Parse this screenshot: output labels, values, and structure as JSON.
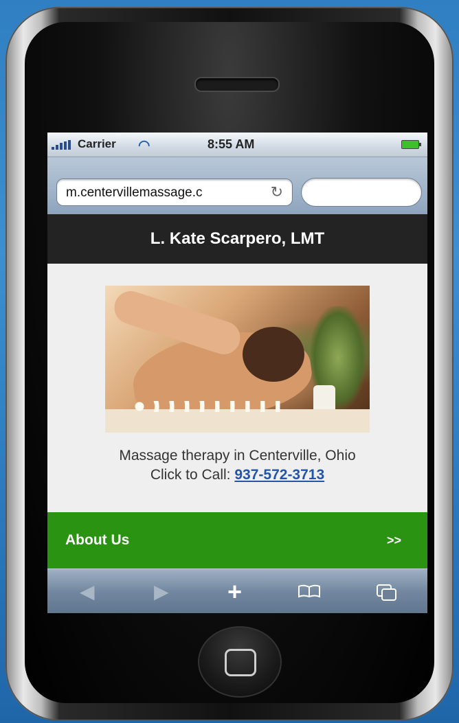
{
  "status_bar": {
    "carrier": "Carrier",
    "time": "8:55 AM"
  },
  "browser": {
    "url": "m.centervillemassage.c",
    "search_placeholder": ""
  },
  "page": {
    "header_title": "L. Kate Scarpero, LMT",
    "tagline": "Massage therapy in Centerville, Ohio",
    "call_label": "Click to Call:",
    "phone_number": "937-572-3713",
    "about_label": "About Us",
    "about_arrow": ">>"
  },
  "toolbar": {
    "back_icon": "◀",
    "forward_icon": "▶",
    "add_icon": "+"
  },
  "colors": {
    "header_bg": "#232323",
    "about_bg": "#2a9312",
    "link": "#2255aa"
  }
}
